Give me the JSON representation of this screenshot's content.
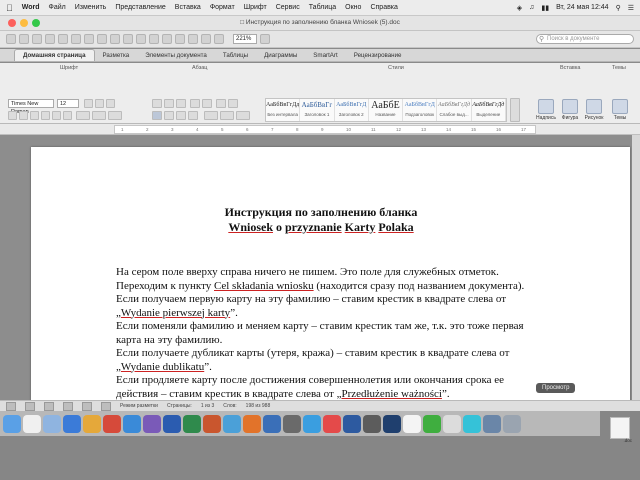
{
  "menubar": {
    "app": "Word",
    "items": [
      "Файл",
      "Изменить",
      "Представление",
      "Вставка",
      "Формат",
      "Шрифт",
      "Сервис",
      "Таблица",
      "Окно",
      "Справка"
    ],
    "clock": "Вт, 24 мая  12:44"
  },
  "window": {
    "title": "Инструкция по заполнению бланка Wniosek (5).doc"
  },
  "toolbar": {
    "zoom": "221%",
    "search_placeholder": "Поиск в документе"
  },
  "ribbon": {
    "tabs": [
      "Домашняя страница",
      "Разметка",
      "Элементы документа",
      "Таблицы",
      "Диаграммы",
      "SmartArt",
      "Рецензирование"
    ],
    "groups": [
      "Шрифт",
      "Абзац",
      "Стили",
      "Вставка",
      "Темы"
    ],
    "font_name": "Times New Roman",
    "font_size": "12",
    "styles": [
      {
        "sample": "АаБбВвГгДд",
        "name": "Без интервала"
      },
      {
        "sample": "АаБбВвГг",
        "name": "Заголовок 1"
      },
      {
        "sample": "АаБбВвГгД",
        "name": "Заголовок 2"
      },
      {
        "sample": "АаБбЕ",
        "name": "Название"
      },
      {
        "sample": "АаБбВвГгД",
        "name": "Подзаголовок"
      },
      {
        "sample": "АаБбВвГгДд",
        "name": "Слабое выд..."
      },
      {
        "sample": "АаБбВвГгДд",
        "name": "Выделение"
      }
    ],
    "right_buttons": [
      "Надпись",
      "Фигура",
      "Рисунок",
      "Темы"
    ]
  },
  "ruler": {
    "ticks": [
      "1",
      "2",
      "3",
      "4",
      "5",
      "6",
      "7",
      "8",
      "9",
      "10",
      "11",
      "12",
      "13",
      "14",
      "15",
      "16",
      "17"
    ]
  },
  "document": {
    "title_line1": "Инструкция по заполнению бланка",
    "title_line2_parts": [
      "Wniosek",
      " o ",
      "przyznanie",
      " ",
      "Karty",
      " ",
      "Polaka"
    ],
    "paragraphs": [
      "На сером поле вверху справа ничего не пишем. Это поле для служебных отметок.",
      [
        "Переходим к пункту ",
        "Cel składania wniosku",
        " (находится сразу под названием документа)."
      ],
      "Если получаем первую карту на эту фамилию – ставим крестик в квадрате слева от",
      [
        "„",
        "Wydanie pierwszej karty",
        "”."
      ],
      "Если поменяли фамилию и меняем карту – ставим крестик там же, т.к. это тоже первая",
      "карта на эту фамилию.",
      "Если получаете дубликат карты (утеря, кража) – ставим крестик в квадрате слева от",
      [
        "„",
        "Wydanie dublikatu",
        "”."
      ],
      "Если продляете карту после достижения совершеннолетия или окончания срока ее",
      [
        "действия – ставим крестик в квадрате слева от „",
        "Przedłużenie ważności",
        "”."
      ]
    ]
  },
  "tooltip": "Просмотр",
  "statusbar": {
    "mode": "Режим разметки",
    "pages_label": "Страницы:",
    "pages_value": "1 из 3",
    "words_label": "Слов:",
    "words_value": "198 из 988"
  },
  "desktop": {
    "file_label": ".doc"
  },
  "colors": {
    "ribbon": "#ededed",
    "doc_background": "#8d8d8d",
    "underline": "#cc2222"
  }
}
